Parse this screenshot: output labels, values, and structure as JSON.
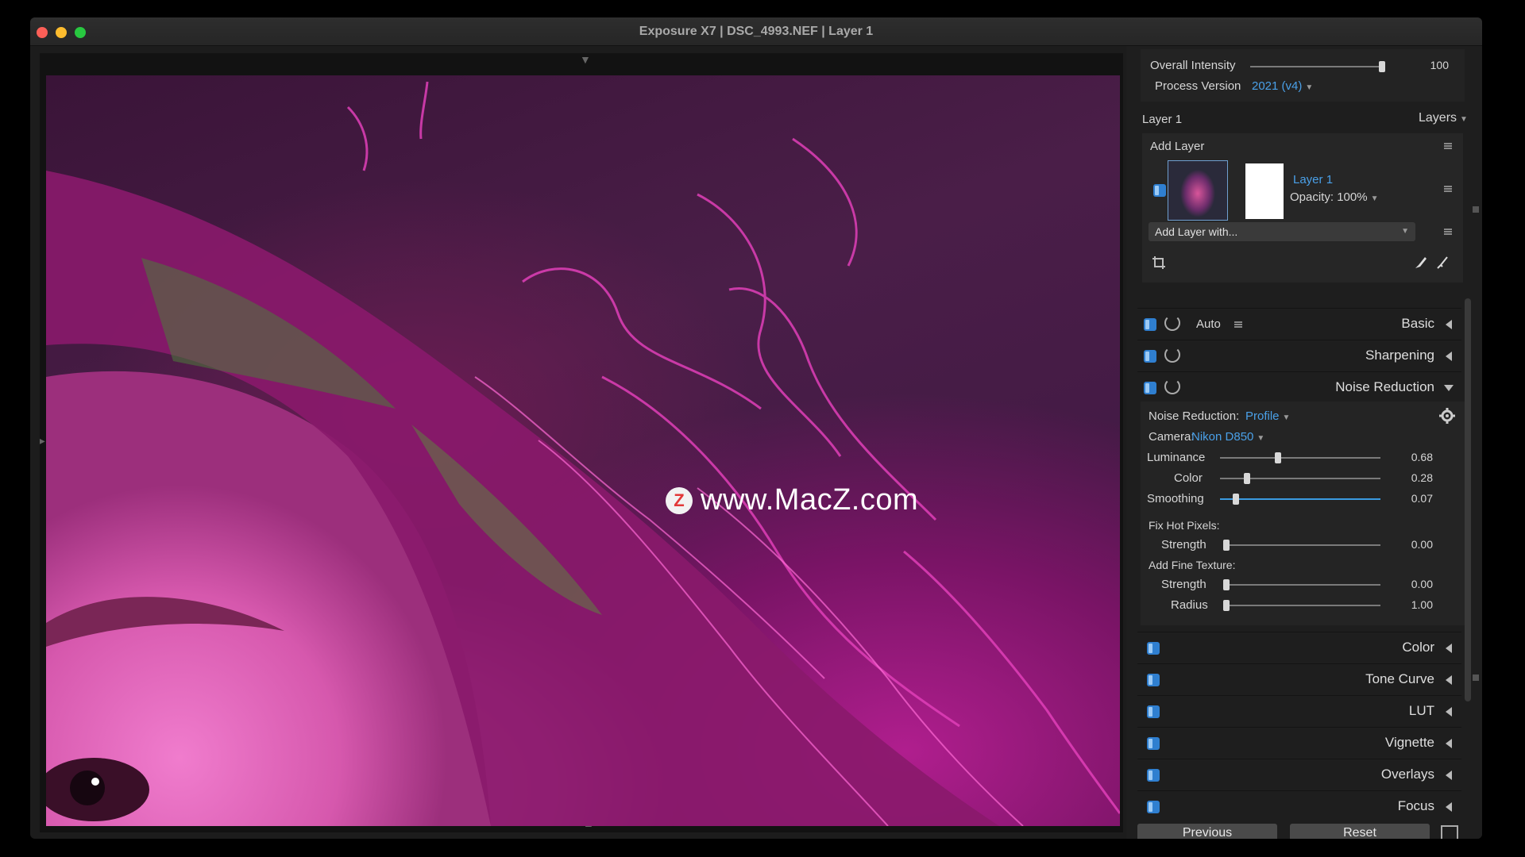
{
  "window": {
    "title": "Exposure X7 | DSC_4993.NEF | Layer 1"
  },
  "watermark": {
    "logo": "Z",
    "text": "www.MacZ.com"
  },
  "top": {
    "overall_intensity": {
      "label": "Overall Intensity",
      "value": "100",
      "fraction": 1.0
    },
    "process_version": {
      "label": "Process Version",
      "value": "2021 (v4)"
    }
  },
  "layers": {
    "current_layer": "Layer 1",
    "panel_label": "Layers",
    "add_layer": "Add Layer",
    "layer_name": "Layer 1",
    "opacity_label": "Opacity:",
    "opacity_value": "100%",
    "add_layer_with": "Add Layer with..."
  },
  "adjustments": {
    "basic": {
      "auto_label": "Auto",
      "title": "Basic"
    },
    "sharpening": "Sharpening",
    "noise_reduction": {
      "title": "Noise Reduction",
      "mode_label": "Noise Reduction:",
      "mode_value": "Profile",
      "camera_label": "Camera:",
      "camera_value": "Nikon D850",
      "sliders": [
        {
          "label": "Luminance",
          "value": "0.68",
          "fraction": 0.34
        },
        {
          "label": "Color",
          "value": "0.28",
          "fraction": 0.15
        },
        {
          "label": "Smoothing",
          "value": "0.07",
          "fraction": 0.08
        }
      ],
      "fix_hot_pixels": "Fix Hot Pixels:",
      "hot_strength": {
        "label": "Strength",
        "value": "0.00",
        "fraction": 0
      },
      "add_fine_texture": "Add Fine Texture:",
      "texture_strength": {
        "label": "Strength",
        "value": "0.00",
        "fraction": 0
      },
      "texture_radius": {
        "label": "Radius",
        "value": "1.00",
        "fraction": 0
      }
    },
    "collapsed": [
      "Color",
      "Tone Curve",
      "LUT",
      "Vignette",
      "Overlays",
      "Focus"
    ]
  },
  "footer": {
    "previous": "Previous",
    "reset": "Reset"
  },
  "colors": {
    "accent": "#4aa0e8",
    "toggle": "#2f7fd0",
    "panel": "#1e1e1e"
  },
  "icons": [
    "crop-icon",
    "brush-icon",
    "gear-icon",
    "reset-icon",
    "menu-icon"
  ]
}
